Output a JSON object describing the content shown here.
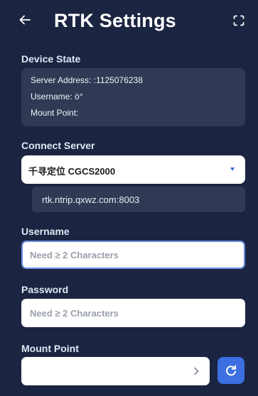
{
  "header": {
    "title": "RTK Settings",
    "back_icon": "back-arrow-icon",
    "fullscreen_icon": "fullscreen-icon"
  },
  "device_state": {
    "label": "Device State",
    "server_address": "Server Address: :1125076238",
    "username": "Username: ò°",
    "mount_point": "Mount Point:"
  },
  "connect_server": {
    "label": "Connect Server",
    "selected": "千寻定位 CGCS2000",
    "address": "rtk.ntrip.qxwz.com:8003"
  },
  "username": {
    "label": "Username",
    "value": "",
    "placeholder": "Need ≥ 2 Characters"
  },
  "password": {
    "label": "Password",
    "value": "",
    "placeholder": "Need ≥ 2 Characters"
  },
  "mount_point": {
    "label": "Mount Point",
    "value": "",
    "chevron_icon": "chevron-right-icon",
    "refresh_icon": "refresh-icon"
  },
  "colors": {
    "background": "#1b2541",
    "card": "#303a55",
    "accent": "#3d6fe3",
    "focus_border": "#6a8ee3"
  }
}
